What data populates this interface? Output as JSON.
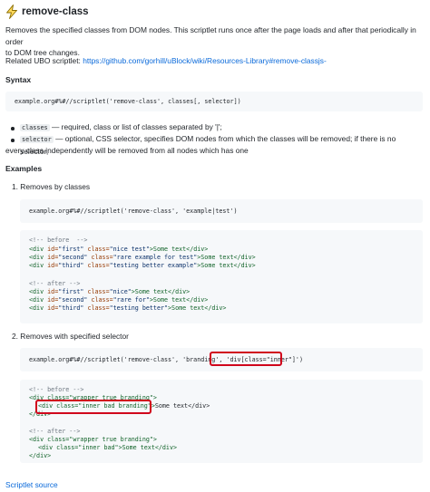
{
  "header": {
    "title": "remove-class",
    "icon": "lightning-bolt-icon"
  },
  "description": {
    "line1": "Removes the specified classes from DOM nodes. This scriptlet runs once after the page loads and after that periodically in order",
    "line2": "to DOM tree changes."
  },
  "related": {
    "label": "Related UBO scriptlet: ",
    "link": "https://github.com/gorhill/uBlock/wiki/Resources-Library#remove-classjs-"
  },
  "syntax": {
    "heading": "Syntax",
    "code": "example.org#%#//scriptlet('remove-class', classes[, selector])"
  },
  "params": [
    {
      "name": "classes",
      "text": " — required, class or list of classes separated by '|';"
    },
    {
      "name": "selector",
      "text_line1": " — optional, CSS selector, specifies DOM nodes from which the classes will be removed; if there is no selector,",
      "text_line2": "every class independently will be removed from all nodes which has one"
    }
  ],
  "examples": {
    "heading": "Examples",
    "item1": {
      "label": "1. Removes by classes",
      "rule": "example.org#%#//scriptlet('remove-class', 'example|test')",
      "before_comment": "<!-- before  -->",
      "before": [
        {
          "open": "<div ",
          "id_attr": "id=",
          "id_val": "\"first\"",
          "cls_attr": " class=",
          "cls_val": "\"nice test\"",
          "rest": ">Some text</div>"
        },
        {
          "open": "<div ",
          "id_attr": "id=",
          "id_val": "\"second\"",
          "cls_attr": " class=",
          "cls_val": "\"rare example for test\"",
          "rest": ">Some text</div>"
        },
        {
          "open": "<div ",
          "id_attr": "id=",
          "id_val": "\"third\"",
          "cls_attr": " class=",
          "cls_val": "\"testing better example\"",
          "rest": ">Some text</div>"
        }
      ],
      "after_comment": "<!-- after -->",
      "after": [
        {
          "open": "<div ",
          "id_attr": "id=",
          "id_val": "\"first\"",
          "cls_attr": " class=",
          "cls_val": "\"nice\"",
          "rest": ">Some text</div>"
        },
        {
          "open": "<div ",
          "id_attr": "id=",
          "id_val": "\"second\"",
          "cls_attr": " class=",
          "cls_val": "\"rare for\"",
          "rest": ">Some text</div>"
        },
        {
          "open": "<div ",
          "id_attr": "id=",
          "id_val": "\"third\"",
          "cls_attr": " class=",
          "cls_val": "\"testing better\"",
          "rest": ">Some text</div>"
        }
      ]
    },
    "item2": {
      "label": "2. Removes with specified selector",
      "rule_prefix": "example.org#%#//scriptlet('remove-class', 'branding', ",
      "rule_selector": "'div[class=\"inner\"]'",
      "rule_suffix": ")",
      "before_comment": "<!-- before -->",
      "before_l1": "<div class=\"wrapper true branding\">",
      "before_l2_tag": "<div class=\"inner bad branding\">",
      "before_l2_rest": "Some text</div>",
      "before_l3": "</div>",
      "after_comment": "<!-- after -->",
      "after_l1": "<div class=\"wrapper true branding\">",
      "after_l2": "<div class=\"inner bad\">Some text</div>",
      "after_l3": "</div>"
    }
  },
  "footer": {
    "link": "Scriptlet source"
  },
  "colors": {
    "link": "#0969da",
    "highlight_box": "#d0021b",
    "code_bg": "#f6f8fa"
  }
}
